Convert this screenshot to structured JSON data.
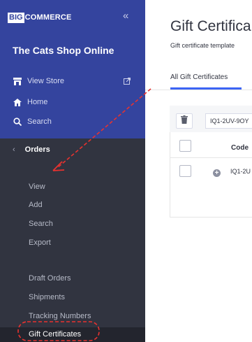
{
  "sidebar": {
    "logo_big": "BIG",
    "logo_rest": "COMMERCE",
    "collapse_glyph": "«",
    "store_name": "The Cats Shop Online",
    "top_items": [
      {
        "label": "View Store",
        "icon": "storefront-icon"
      },
      {
        "label": "Home",
        "icon": "home-icon"
      },
      {
        "label": "Search",
        "icon": "search-icon"
      }
    ],
    "orders": {
      "label": "Orders",
      "sub_items": [
        "View",
        "Add",
        "Search",
        "Export",
        "Draft Orders",
        "Shipments",
        "Tracking Numbers",
        "Gift Certificates"
      ],
      "active": "Gift Certificates"
    }
  },
  "main": {
    "title": "Gift Certifica",
    "subtitle": "Gift certificate template",
    "tabs": [
      {
        "label": "All Gift Certificates",
        "active": true
      }
    ],
    "toolbar": {
      "search_value": "IQ1-2UV-9OY"
    },
    "table": {
      "columns": [
        "Code"
      ],
      "rows": [
        {
          "code": "IQ1-2U"
        }
      ]
    }
  },
  "annotations": {
    "color": "#e8322f"
  }
}
